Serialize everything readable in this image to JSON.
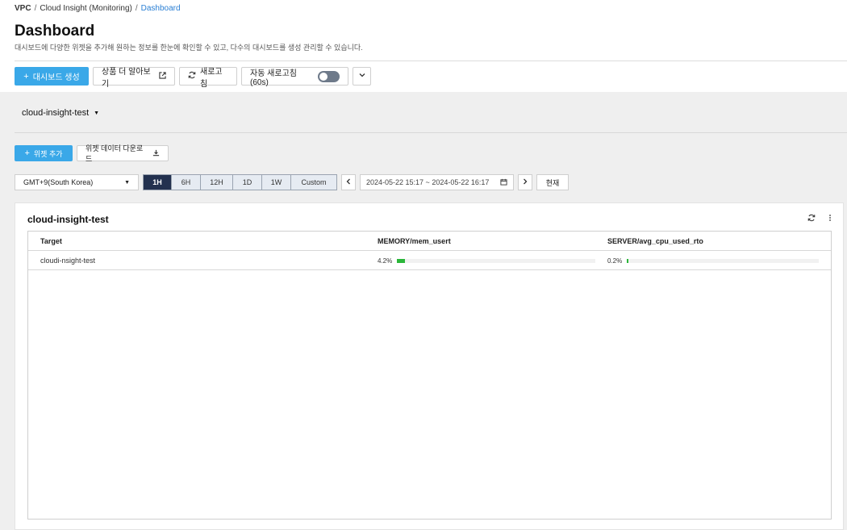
{
  "breadcrumb": {
    "items": [
      "VPC",
      "Cloud Insight (Monitoring)",
      "Dashboard"
    ],
    "separator": "/"
  },
  "page": {
    "title": "Dashboard",
    "description": "대시보드에 다양한 위젯을 추가해 원하는 정보를 한눈에 확인할 수 있고, 다수의 대시보드를 생성 관리할 수 있습니다."
  },
  "toolbar": {
    "create_dashboard": "대시보드 생성",
    "learn_more": "상품 더 알아보기",
    "refresh": "새로고침",
    "auto_refresh": "자동 새로고침(60s)",
    "auto_refresh_on": false
  },
  "dashboard_select": {
    "value": "cloud-insight-test"
  },
  "widget_bar": {
    "add_widget": "위젯 추가",
    "download": "위젯 데이터 다운로드"
  },
  "time_controls": {
    "timezone": "GMT+9(South Korea)",
    "ranges": [
      "1H",
      "6H",
      "12H",
      "1D",
      "1W",
      "Custom"
    ],
    "active_range": "1H",
    "date_range": "2024-05-22 15:17 ~ 2024-05-22 16:17",
    "now_label": "현재"
  },
  "widget": {
    "title": "cloud-insight-test",
    "columns": [
      "Target",
      "MEMORY/mem_usert",
      "SERVER/avg_cpu_used_rto"
    ],
    "rows": [
      {
        "target": "cloudi-nsight-test",
        "memory_label": "4.2%",
        "memory_value": 4.2,
        "cpu_label": "0.2%",
        "cpu_value": 0.2
      }
    ]
  },
  "colors": {
    "primary": "#3aa8e8",
    "active_range": "#23314f",
    "bar_fill": "#2bb63a",
    "breadcrumb_current": "#2a7fd4",
    "toggle_off": "#6e7a8a"
  },
  "icons": {
    "plus": "plus-icon",
    "external_link": "external-link-icon",
    "refresh": "refresh-icon",
    "chevron_down": "chevron-down-icon",
    "caret_down": "caret-down-icon",
    "download": "download-icon",
    "calendar": "calendar-icon",
    "chevron_left": "chevron-left-icon",
    "chevron_right": "chevron-right-icon",
    "more": "more-vertical-icon"
  }
}
